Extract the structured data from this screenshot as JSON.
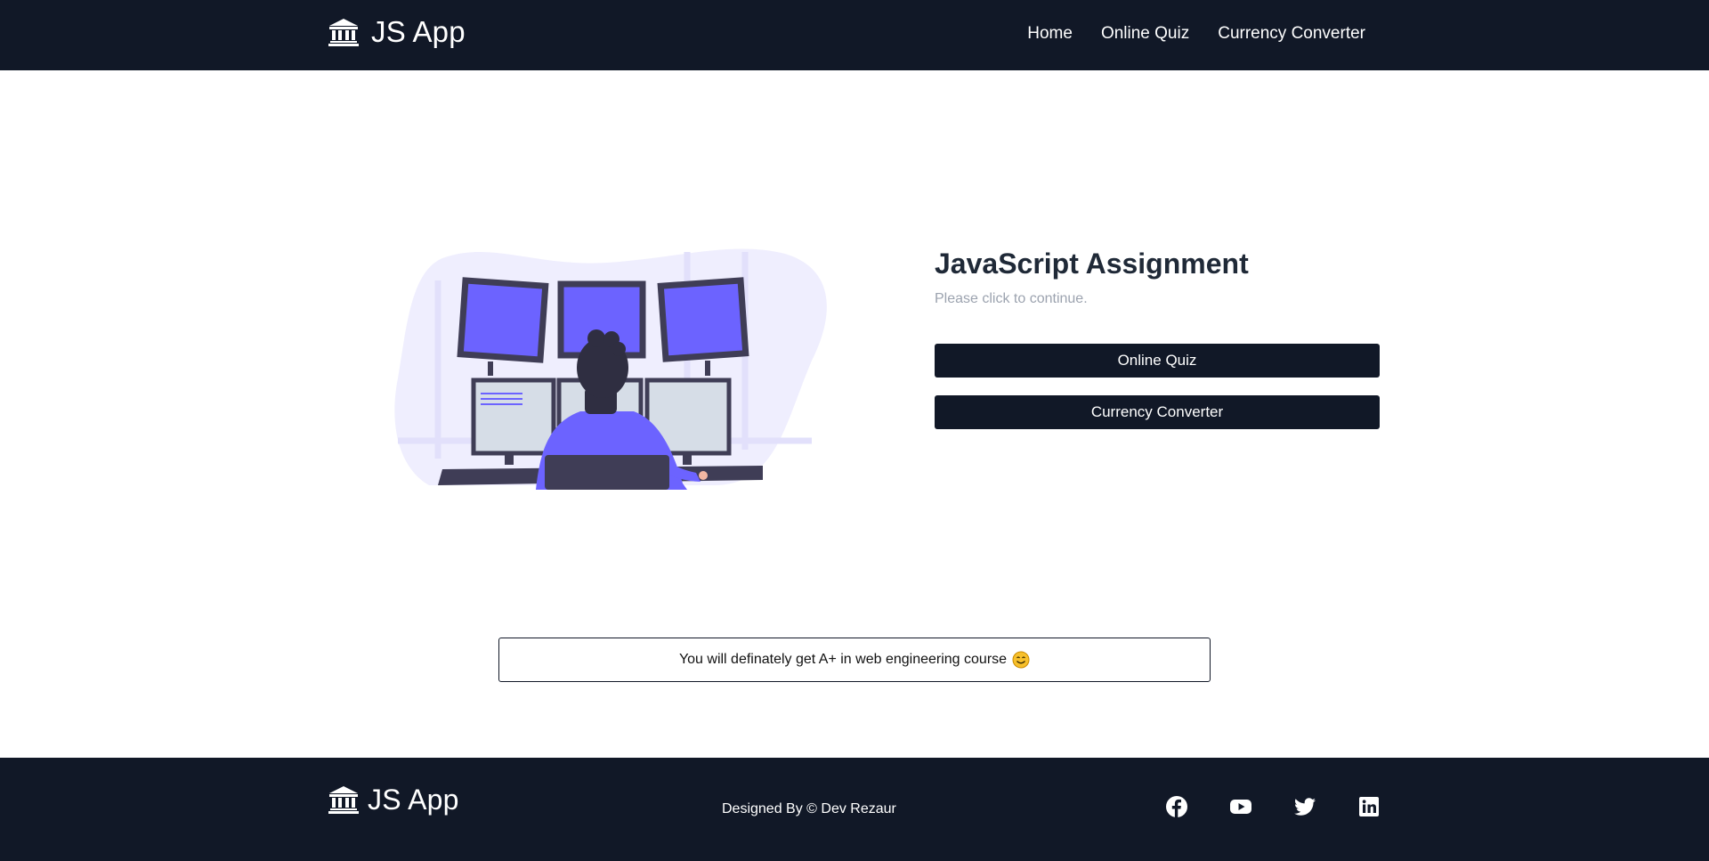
{
  "header": {
    "brand_name": "JS App",
    "brand_icon": "bank-building-icon",
    "nav": [
      {
        "label": "Home"
      },
      {
        "label": "Online Quiz"
      },
      {
        "label": "Currency Converter"
      }
    ]
  },
  "hero": {
    "illustration": "developer-at-monitors-illustration",
    "title": "JavaScript Assignment",
    "subtitle": "Please click to continue.",
    "buttons": {
      "quiz_label": "Online Quiz",
      "currency_label": "Currency Converter"
    }
  },
  "message": {
    "text": "You will definately get A+ in web engineering course",
    "emoji": "smiling-face-icon"
  },
  "footer": {
    "brand_name": "JS App",
    "credit": "Designed By  © Dev Rezaur",
    "social": [
      "facebook-icon",
      "youtube-icon",
      "twitter-icon",
      "linkedin-icon"
    ]
  },
  "colors": {
    "dark": "#111827",
    "accent": "#6c63ff",
    "muted_text": "#9ca3af"
  }
}
